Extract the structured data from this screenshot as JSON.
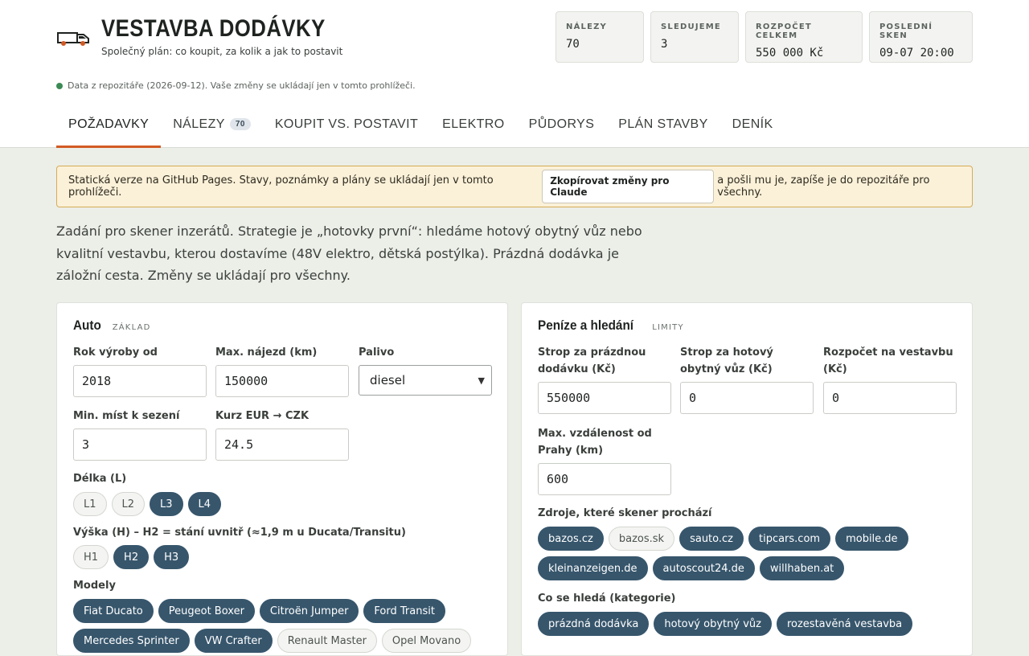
{
  "app": {
    "title": "VESTAVBA DODÁVKY",
    "subtitle": "Společný plán: co koupit, za kolik a jak to postavit",
    "data_note": "Data z repozitáře (2026-09-12). Vaše změny se ukládají jen v tomto prohlížeči."
  },
  "stats": [
    {
      "label": "NÁLEZY",
      "value": "70"
    },
    {
      "label": "SLEDUJEME",
      "value": "3"
    },
    {
      "label": "ROZPOČET CELKEM",
      "value": "550 000 Kč"
    },
    {
      "label": "POSLEDNÍ SKEN",
      "value": "09-07 20:00"
    }
  ],
  "tabs": [
    {
      "label": "POŽADAVKY",
      "active": true
    },
    {
      "label": "NÁLEZY",
      "badge": "70"
    },
    {
      "label": "KOUPIT VS. POSTAVIT"
    },
    {
      "label": "ELEKTRO"
    },
    {
      "label": "PŮDORYS"
    },
    {
      "label": "PLÁN STAVBY"
    },
    {
      "label": "DENÍK"
    }
  ],
  "banner": {
    "text_before": "Statická verze na GitHub Pages. Stavy, poznámky a plány se ukládají jen v tomto prohlížeči.",
    "button": "Zkopírovat změny pro Claude",
    "text_after": "a pošli mu je, zapíše je do repozitáře pro všechny."
  },
  "intro": "Zadání pro skener inzerátů. Strategie je „hotovky první“: hledáme hotový obytný vůz nebo kvalitní vestavbu, kterou dostavíme (48V elektro, dětská postýlka). Prázdná dodávka je záložní cesta. Změny se ukládají pro všechny.",
  "auto": {
    "title": "Auto",
    "tag": "ZÁKLAD",
    "year_label": "Rok výroby od",
    "year_value": "2018",
    "mileage_label": "Max. nájezd (km)",
    "mileage_value": "150000",
    "fuel_label": "Palivo",
    "fuel_value": "diesel",
    "seats_label": "Min. míst k sezení",
    "seats_value": "3",
    "rate_label": "Kurz EUR → CZK",
    "rate_value": "24.5",
    "length_label": "Délka (L)",
    "lengths": [
      {
        "label": "L1",
        "on": false
      },
      {
        "label": "L2",
        "on": false
      },
      {
        "label": "L3",
        "on": true
      },
      {
        "label": "L4",
        "on": true
      }
    ],
    "height_label": "Výška (H) – H2 = stání uvnitř (≈1,9 m u Ducata/Transitu)",
    "heights": [
      {
        "label": "H1",
        "on": false
      },
      {
        "label": "H2",
        "on": true
      },
      {
        "label": "H3",
        "on": true
      }
    ],
    "models_label": "Modely",
    "models": [
      {
        "label": "Fiat Ducato",
        "on": true
      },
      {
        "label": "Peugeot Boxer",
        "on": true
      },
      {
        "label": "Citroën Jumper",
        "on": true
      },
      {
        "label": "Ford Transit",
        "on": true
      },
      {
        "label": "Mercedes Sprinter",
        "on": true
      },
      {
        "label": "VW Crafter",
        "on": true
      },
      {
        "label": "Renault Master",
        "on": false
      },
      {
        "label": "Opel Movano",
        "on": false
      }
    ]
  },
  "money": {
    "title": "Peníze a hledání",
    "tag": "LIMITY",
    "empty_van_label": "Strop za prázdnou dodávku (Kč)",
    "empty_van_value": "550000",
    "camper_label": "Strop za hotový obytný vůz (Kč)",
    "camper_value": "0",
    "build_label": "Rozpočet na vestavbu (Kč)",
    "build_value": "0",
    "distance_label": "Max. vzdálenost od Prahy (km)",
    "distance_value": "600",
    "sources_label": "Zdroje, které skener prochází",
    "sources": [
      {
        "label": "bazos.cz",
        "on": true
      },
      {
        "label": "bazos.sk",
        "on": false
      },
      {
        "label": "sauto.cz",
        "on": true
      },
      {
        "label": "tipcars.com",
        "on": true
      },
      {
        "label": "mobile.de",
        "on": true
      },
      {
        "label": "kleinanzeigen.de",
        "on": true
      },
      {
        "label": "autoscout24.de",
        "on": true
      },
      {
        "label": "willhaben.at",
        "on": true
      }
    ],
    "categories_label": "Co se hledá (kategorie)",
    "categories": [
      {
        "label": "prázdná dodávka",
        "on": true
      },
      {
        "label": "hotový obytný vůz",
        "on": true
      },
      {
        "label": "rozestavěná vestavba",
        "on": true
      }
    ]
  },
  "icons": {
    "logo": "van-icon"
  },
  "colors": {
    "accent": "#d25a24",
    "chip_on": "#37566c",
    "banner_bg": "#fbf1d9",
    "status_dot": "#3b8a55"
  }
}
